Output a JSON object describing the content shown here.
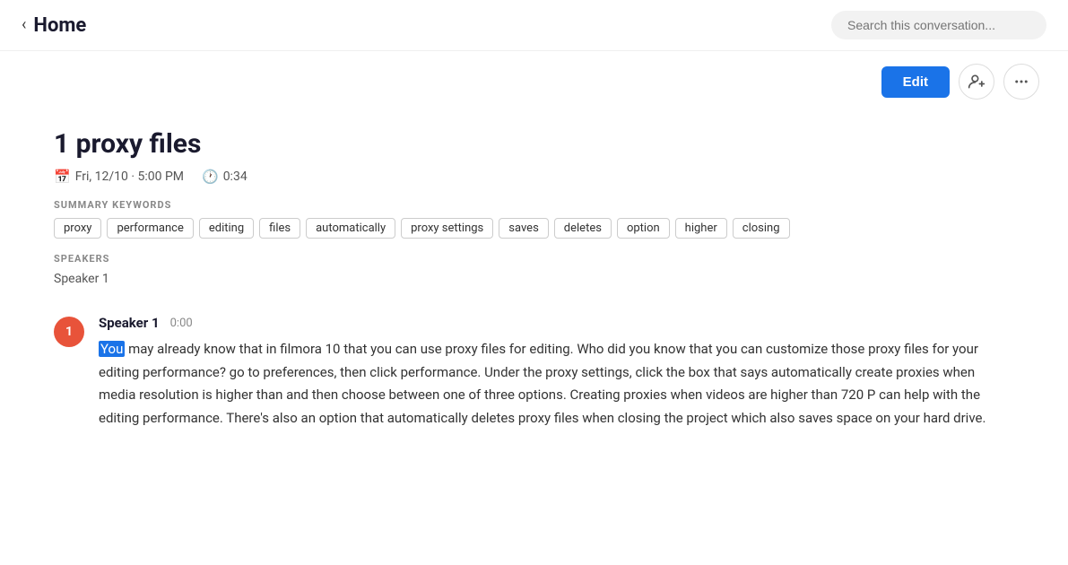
{
  "header": {
    "back_label": "Home",
    "search_placeholder": "Search this conversation..."
  },
  "toolbar": {
    "edit_label": "Edit",
    "add_person_icon": "＋👤",
    "more_icon": "•••"
  },
  "conversation": {
    "title": "1 proxy files",
    "date": "Fri, 12/10 · 5:00 PM",
    "duration": "0:34"
  },
  "keywords_section": {
    "label": "SUMMARY KEYWORDS",
    "keywords": [
      "proxy",
      "performance",
      "editing",
      "files",
      "automatically",
      "proxy settings",
      "saves",
      "deletes",
      "option",
      "higher",
      "closing"
    ]
  },
  "speakers_section": {
    "label": "SPEAKERS",
    "speakers": [
      "Speaker 1"
    ]
  },
  "transcript": [
    {
      "badge": "1",
      "speaker": "Speaker 1",
      "timestamp": "0:00",
      "highlighted_word": "You",
      "text": " may already know that in filmora 10 that you can use proxy files for editing. Who did you know that you can customize those proxy files for your editing performance? go to preferences, then click performance. Under the proxy settings, click the box that says automatically create proxies when media resolution is higher than and then choose between one of three options. Creating proxies when videos are higher than 720 P can help with the editing performance. There's also an option that automatically deletes proxy files when closing the project which also saves space on your hard drive."
    }
  ]
}
